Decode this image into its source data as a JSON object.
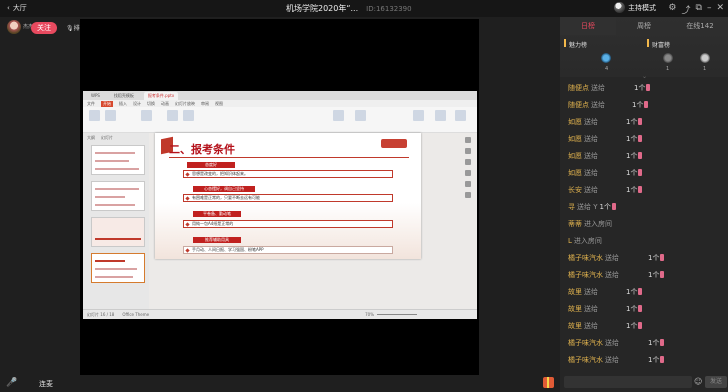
{
  "topbar": {
    "hall_label": "大厅",
    "title": "机场学院2020年“...",
    "room_id": "ID:16132390",
    "host_mode": "主持模式",
    "icons": [
      "settings-icon",
      "share-icon",
      "popout-icon",
      "minimize-icon",
      "close-icon"
    ]
  },
  "streamer": {
    "name": "杰杰",
    "follow_label": "关注",
    "queue_label": "排麦"
  },
  "bottombar": {
    "mic_label": "连麦"
  },
  "ppt": {
    "heading": "二、报考条件",
    "sections": [
      {
        "badge": "态度好",
        "line": "思想是改变的，把知识体起来。"
      },
      {
        "badge": "心态摆好，调自己坚持",
        "line": "有困难是正常的，只要不断去远有可能"
      },
      {
        "badge": "平卷备、勤动笔",
        "line": "用纯一包A4纸是正常的"
      },
      {
        "badge": "推荐辅助用具",
        "line": "手月动、人间日报、学习强国、粉笔APP"
      }
    ],
    "thumb_tabs": [
      "大纲",
      "幻灯片"
    ],
    "status_left": "幻灯片 16 / 18",
    "status_theme": "Office Theme",
    "zoom": "70%"
  },
  "panel": {
    "tabs": [
      "日榜",
      "周榜",
      "在线142"
    ],
    "rank_labels": [
      "魅力榜",
      "财富榜"
    ],
    "rank_numbers": [
      "4",
      "1",
      "1"
    ],
    "messages": [
      {
        "name": "随便点",
        "action": "送给",
        "qty": "1个"
      },
      {
        "name": "随便点",
        "action": "送给",
        "qty": "1个"
      },
      {
        "name": "如愿",
        "action": "送给",
        "qty": "1个"
      },
      {
        "name": "如愿",
        "action": "送给",
        "qty": "1个"
      },
      {
        "name": "如愿",
        "action": "送给",
        "qty": "1个"
      },
      {
        "name": "如愿",
        "action": "送给",
        "qty": "1个"
      },
      {
        "name": "长安",
        "action": "送给",
        "qty": "1个"
      },
      {
        "name": "寻",
        "action": "送给 Y",
        "qty": "1个"
      },
      {
        "name": "蒂蒂",
        "action": "进入房间",
        "qty": ""
      },
      {
        "name": "L",
        "action": "进入房间",
        "qty": ""
      },
      {
        "name": "橘子味汽水",
        "action": "送给",
        "qty": "1个"
      },
      {
        "name": "橘子味汽水",
        "action": "送给",
        "qty": "1个"
      },
      {
        "name": "故里",
        "action": "送给",
        "qty": "1个"
      },
      {
        "name": "故里",
        "action": "送给",
        "qty": "1个"
      },
      {
        "name": "故里",
        "action": "送给",
        "qty": "1个"
      },
      {
        "name": "橘子味汽水",
        "action": "送给",
        "qty": "1个"
      },
      {
        "name": "橘子味汽水",
        "action": "送给",
        "qty": "1个"
      }
    ],
    "send_label": "发送"
  }
}
